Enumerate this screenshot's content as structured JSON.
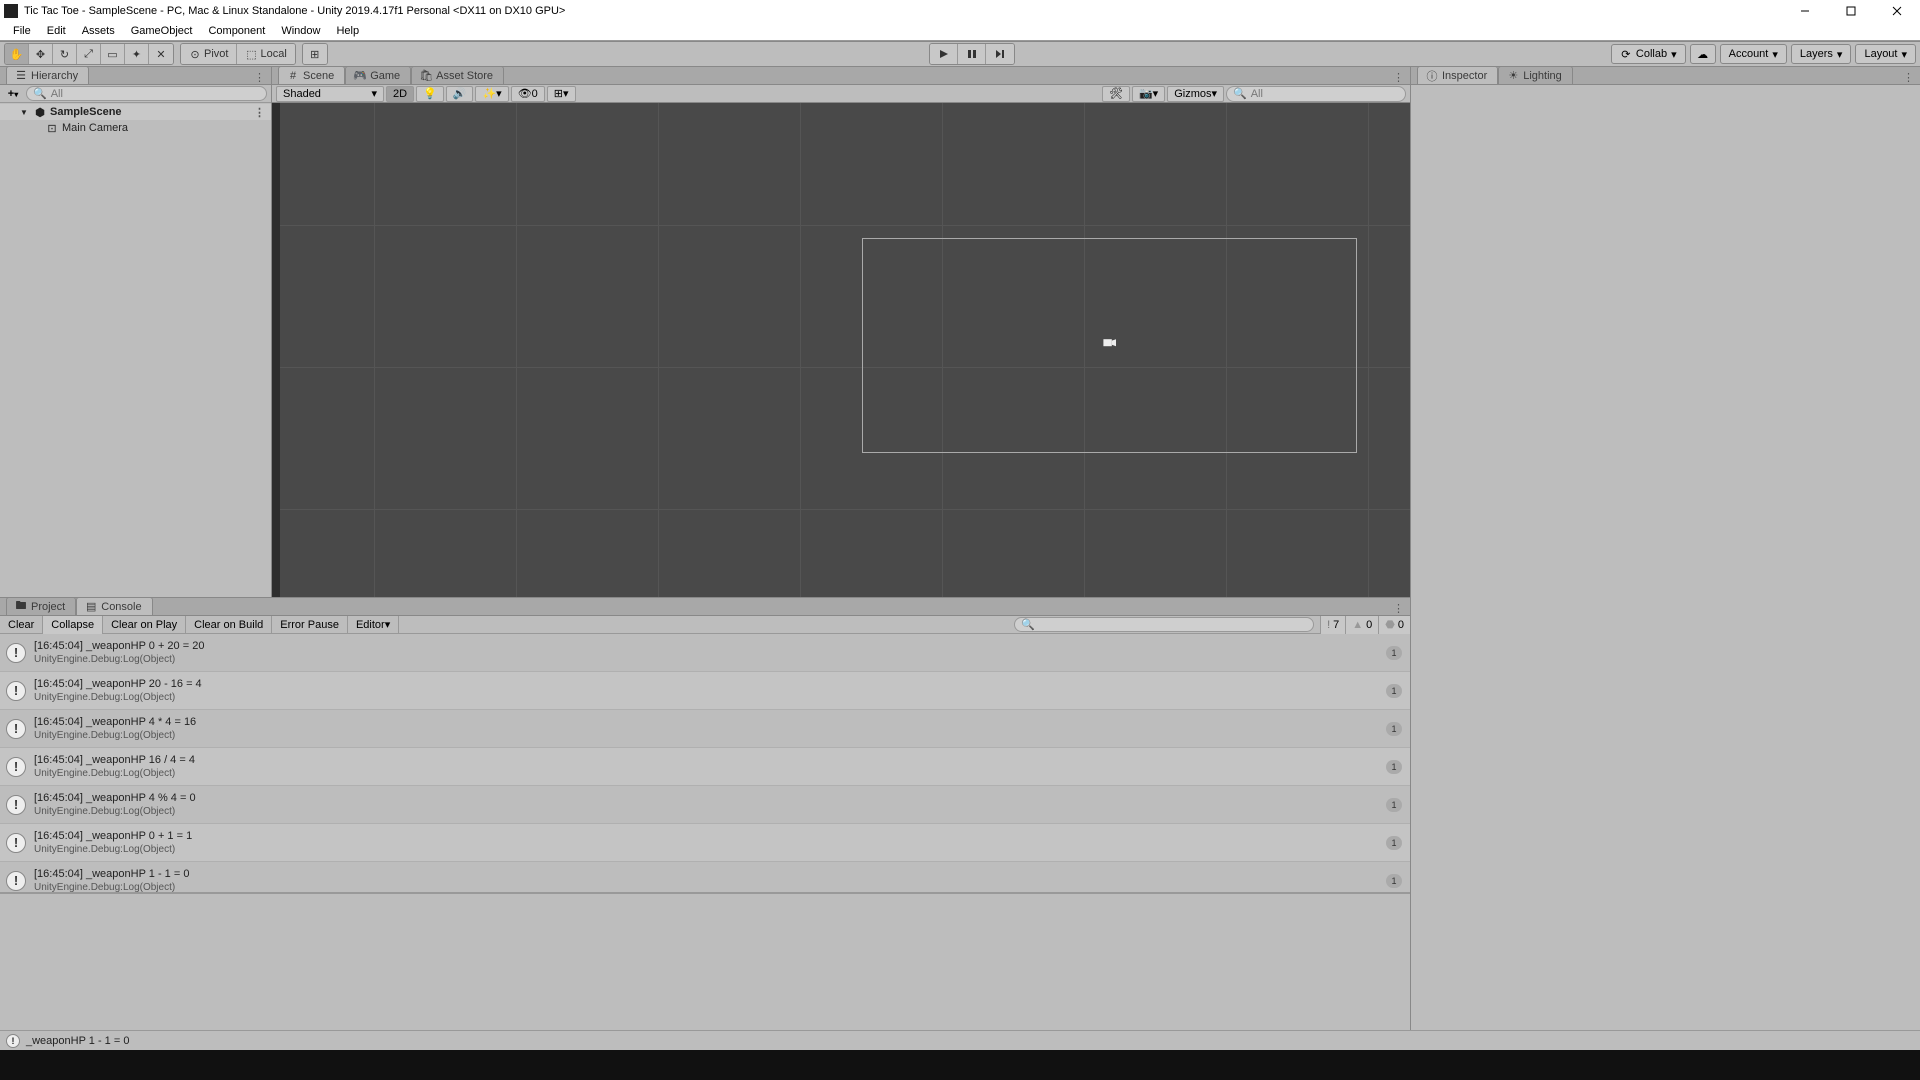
{
  "title": "Tic Tac Toe - SampleScene - PC, Mac & Linux Standalone - Unity 2019.4.17f1 Personal <DX11 on DX10 GPU>",
  "menu": [
    "File",
    "Edit",
    "Assets",
    "GameObject",
    "Component",
    "Window",
    "Help"
  ],
  "toolbar": {
    "pivot": "Pivot",
    "local": "Local",
    "collab": "Collab",
    "account": "Account",
    "layers": "Layers",
    "layout": "Layout"
  },
  "hierarchy": {
    "tab": "Hierarchy",
    "search_placeholder": "All",
    "scene": "SampleScene",
    "items": [
      "Main Camera"
    ]
  },
  "scene": {
    "tabs": [
      "Scene",
      "Game",
      "Asset Store"
    ],
    "shaded": "Shaded",
    "btn_2d": "2D",
    "gizmos": "Gizmos",
    "giz_zero": "0",
    "search_placeholder": "All"
  },
  "inspector": {
    "tabs": [
      "Inspector",
      "Lighting"
    ]
  },
  "bottom": {
    "tabs": [
      "Project",
      "Console"
    ],
    "buttons": {
      "clear": "Clear",
      "collapse": "Collapse",
      "clear_play": "Clear on Play",
      "clear_build": "Clear on Build",
      "error_pause": "Error Pause",
      "editor": "Editor"
    },
    "counts": {
      "info": "7",
      "warn": "0",
      "err": "0"
    }
  },
  "logs": [
    {
      "line1": "[16:45:04] _weaponHP 0 + 20 = 20",
      "line2": "UnityEngine.Debug:Log(Object)",
      "count": "1"
    },
    {
      "line1": "[16:45:04] _weaponHP 20 - 16 = 4",
      "line2": "UnityEngine.Debug:Log(Object)",
      "count": "1"
    },
    {
      "line1": "[16:45:04] _weaponHP 4 * 4 = 16",
      "line2": "UnityEngine.Debug:Log(Object)",
      "count": "1"
    },
    {
      "line1": "[16:45:04] _weaponHP 16 / 4 = 4",
      "line2": "UnityEngine.Debug:Log(Object)",
      "count": "1"
    },
    {
      "line1": "[16:45:04] _weaponHP 4 % 4 = 0",
      "line2": "UnityEngine.Debug:Log(Object)",
      "count": "1"
    },
    {
      "line1": "[16:45:04] _weaponHP 0 + 1 = 1",
      "line2": "UnityEngine.Debug:Log(Object)",
      "count": "1"
    },
    {
      "line1": "[16:45:04] _weaponHP 1 - 1 = 0",
      "line2": "UnityEngine.Debug:Log(Object)",
      "count": "1"
    }
  ],
  "status": "_weaponHP 1 - 1 = 0"
}
